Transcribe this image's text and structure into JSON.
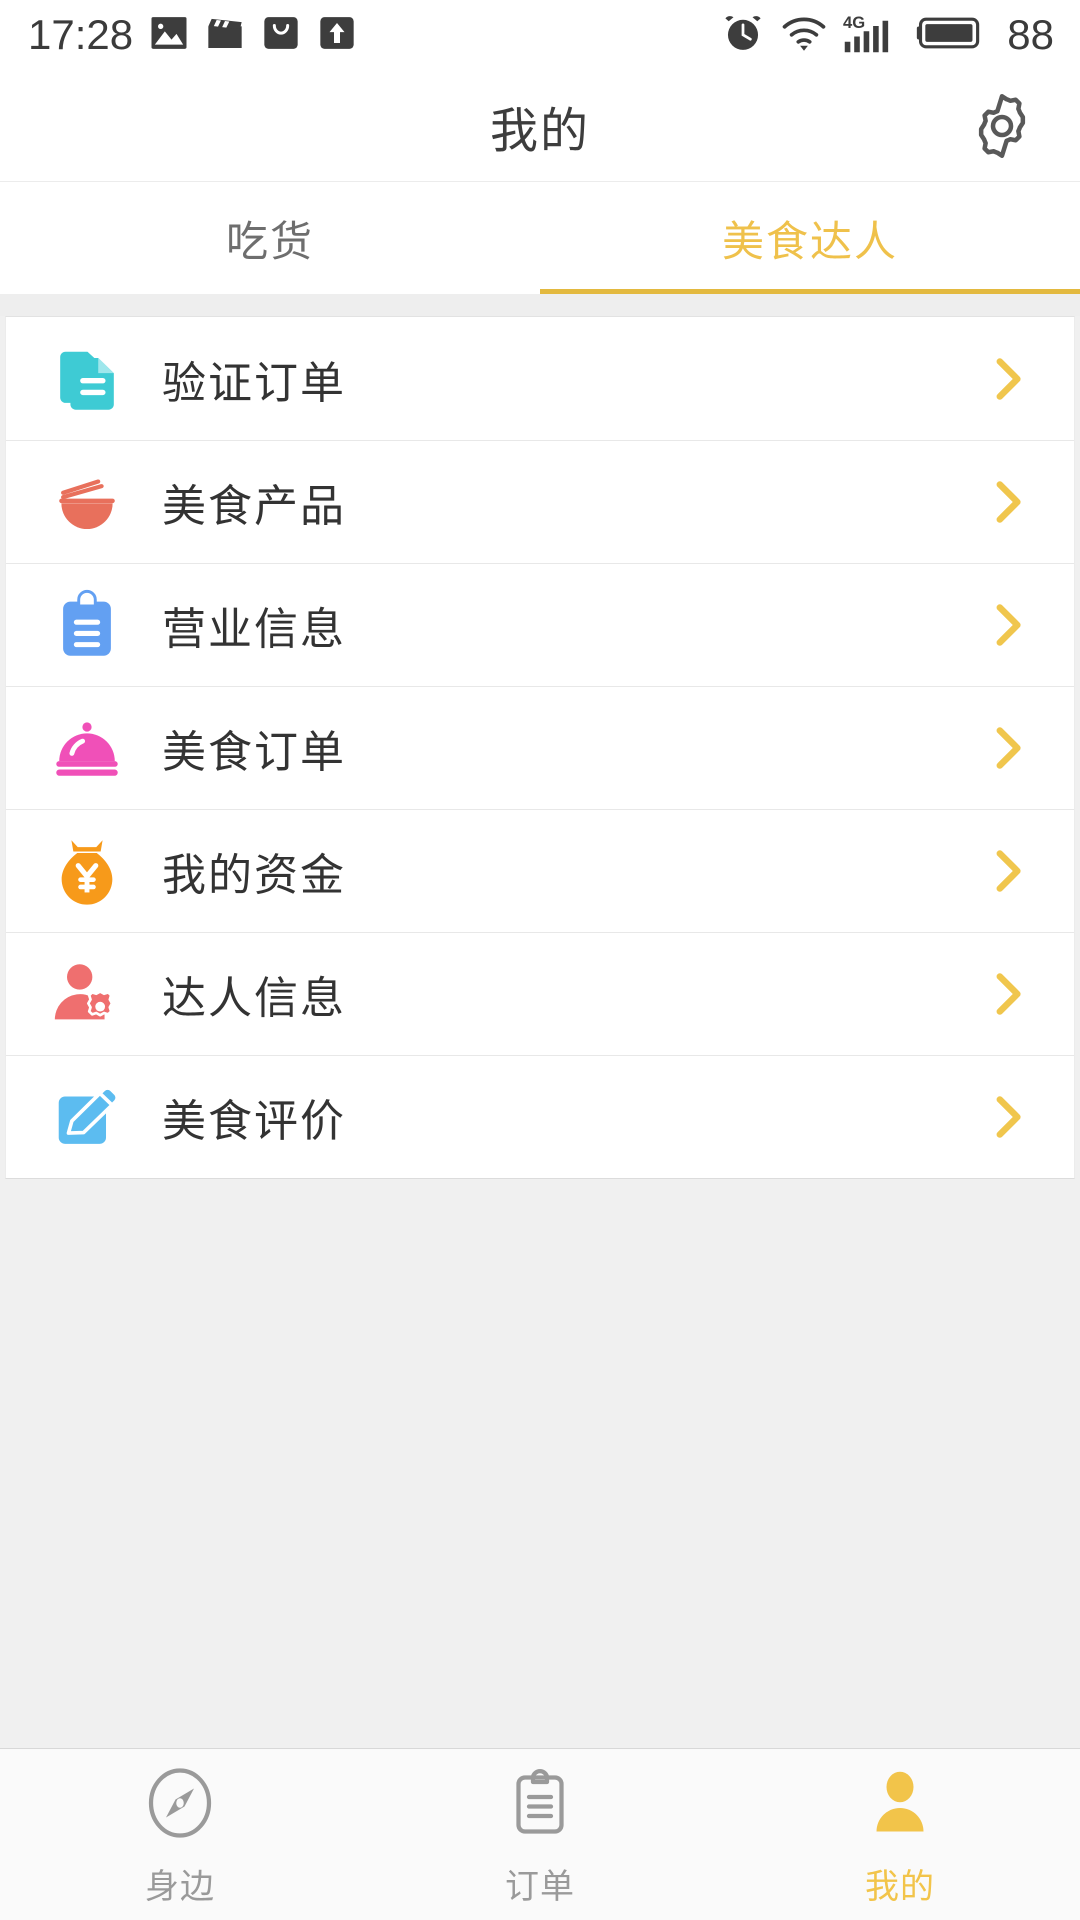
{
  "status_bar": {
    "time": "17:28",
    "battery_percent": "88",
    "network": "4G",
    "left_icons": [
      "image-icon",
      "movie-clapper-icon",
      "bag-icon",
      "upload-arrow-icon"
    ],
    "right_icons": [
      "alarm-clock-icon",
      "wifi-icon",
      "signal-bars-icon",
      "battery-icon"
    ]
  },
  "header": {
    "title": "我的",
    "settings_icon": "gear-icon"
  },
  "tabs": {
    "items": [
      {
        "label": "吃货",
        "active": false
      },
      {
        "label": "美食达人",
        "active": true
      }
    ],
    "active_color": "#efc14b",
    "inactive_color": "#6e6e6e",
    "underline_color": "#e3b93f"
  },
  "menu": {
    "chevron_icon": "chevron-right-icon",
    "chevron_color": "#f0c64d",
    "items": [
      {
        "label": "验证订单",
        "icon": "document-verify-icon",
        "color": "#3ecbd4"
      },
      {
        "label": "美食产品",
        "icon": "noodle-bowl-icon",
        "color": "#e8705c"
      },
      {
        "label": "营业信息",
        "icon": "clipboard-icon",
        "color": "#63a0f2"
      },
      {
        "label": "美食订单",
        "icon": "cloche-icon",
        "color": "#f050b8"
      },
      {
        "label": "我的资金",
        "icon": "money-bag-yen-icon",
        "color": "#f79a1a"
      },
      {
        "label": "达人信息",
        "icon": "person-gear-icon",
        "color": "#ef6f6f"
      },
      {
        "label": "美食评价",
        "icon": "pencil-edit-icon",
        "color": "#5cbcf0"
      }
    ]
  },
  "bottom_nav": {
    "items": [
      {
        "label": "身边",
        "icon": "compass-icon",
        "active": false
      },
      {
        "label": "订单",
        "icon": "clipboard-outline-icon",
        "active": false
      },
      {
        "label": "我的",
        "icon": "person-icon",
        "active": true
      }
    ],
    "active_color": "#f2c44a",
    "inactive_color": "#9a9a9a"
  }
}
